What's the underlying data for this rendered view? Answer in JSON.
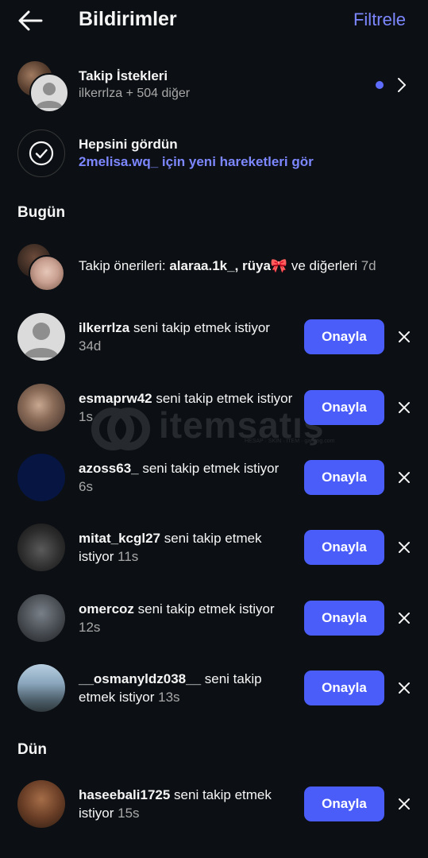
{
  "header": {
    "title": "Bildirimler",
    "filter_label": "Filtrele"
  },
  "follow_requests": {
    "title": "Takip İstekleri",
    "subtitle": "ilkerrlza + 504 diğer"
  },
  "seen_all": {
    "title": "Hepsini gördün",
    "link": "2melisa.wq_ için yeni hareketleri gör"
  },
  "sections": {
    "today": "Bugün",
    "yesterday": "Dün"
  },
  "suggestion": {
    "prefix": "Takip önerileri: ",
    "users": "alaraa.1k_, rüya🎀",
    "suffix": " ve diğerleri ",
    "time": "7d"
  },
  "approve_label": "Onayla",
  "requests": [
    {
      "username": "ilkerrlza",
      "action": " seni takip etmek istiyor ",
      "time": "34d"
    },
    {
      "username": "esmaprw42",
      "action": " seni takip etmek istiyor ",
      "time": "1s"
    },
    {
      "username": "azoss63_",
      "action": " seni takip etmek istiyor ",
      "time": "6s"
    },
    {
      "username": "mitat_kcgl27",
      "action": " seni takip etmek istiyor ",
      "time": "11s"
    },
    {
      "username": "omercoz",
      "action": " seni takip etmek istiyor ",
      "time": "12s"
    },
    {
      "username": "__osmanyldz038__",
      "action": " seni takip etmek istiyor ",
      "time": "13s"
    },
    {
      "username": "haseebali1725",
      "action": " seni takip etmek istiyor ",
      "time": "15s"
    }
  ],
  "watermark": {
    "brand": "itemsatış",
    "tagline": "HESAP · SKIN · ITEM · gaming.com"
  },
  "colors": {
    "background": "#0c1014",
    "accent": "#4a5df9",
    "link": "#7d87ff",
    "secondary_text": "#a8a8a8"
  }
}
